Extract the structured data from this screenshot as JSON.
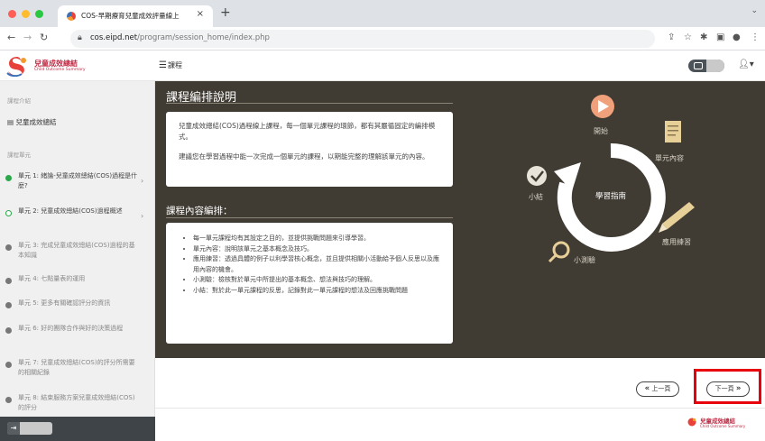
{
  "browser": {
    "tab_title": "COS-早期療育兒童成效評量線上",
    "tab_close": "×",
    "new_tab": "+",
    "url_host": "cos.eipd.net",
    "url_path": "/program/session_home/index.php"
  },
  "header": {
    "logo_title": "兒童成效總結",
    "logo_subtitle": "Child Outcome Summary",
    "menu_label": "課程"
  },
  "sidebar": {
    "section_intro": "課程介紹",
    "intro_item": "兒童成效總結",
    "section_units": "課程單元",
    "units": [
      {
        "label": "單元 1: 緒論-兒童成效總結(COS)過程是什麼?"
      },
      {
        "label": "單元 2: 兒童成效總結(COS)過程概述"
      },
      {
        "label": "單元 3: 完成兒童成效總結(COS)過程的基本知識"
      },
      {
        "label": "單元 4: 七點量表的運用"
      },
      {
        "label": "單元 5: 更多有關確認評分的資訊"
      },
      {
        "label": "單元 6: 好的團隊合作與好的決策過程"
      },
      {
        "label": "單元 7: 兒童成效總結(COS)的評分所需要的相關紀錄"
      },
      {
        "label": "單元 8: 結束服務方案兒童成效總結(COS)的評分"
      }
    ]
  },
  "main": {
    "title": "課程編排說明",
    "intro_paragraphs": [
      "兒童成效總結(COS)過程線上課程，每一個單元課程的環節，都有其嚴循固定的編排模式。",
      "建議您在學習過程中能一次完成一個單元的課程，以期能完整的理解該單元的內容。"
    ],
    "section_title": "課程內容編排：",
    "bullets": [
      "每一單元課程均有其設定之目的，並提供挑戰問題來引導學習。",
      "單元內容：說明該單元之基本概念及技巧。",
      "應用練習：透過具體的例子以利學習核心概念，並且提供相關小活動給予個人反思以及應用內容的機會。",
      "小測驗：檢核對於單元中所提出的基本概念、想法與技巧的理解。",
      "小結：對於此一單元課程的反思，記錄對此一單元課程的想法及回應挑戰問題"
    ],
    "diagram": {
      "center": "學習指南",
      "start": "開始",
      "content": "單元內容",
      "practice": "應用練習",
      "quiz": "小測驗",
      "summary": "小結"
    }
  },
  "pager": {
    "prev": "上一頁",
    "next": "下一頁",
    "prev_arrow": "«",
    "next_arrow": "»"
  },
  "colors": {
    "brand": "#c12b45",
    "panel_bg": "#403b33",
    "active_unit": "#2aa84a",
    "highlight": "#e8000d"
  }
}
